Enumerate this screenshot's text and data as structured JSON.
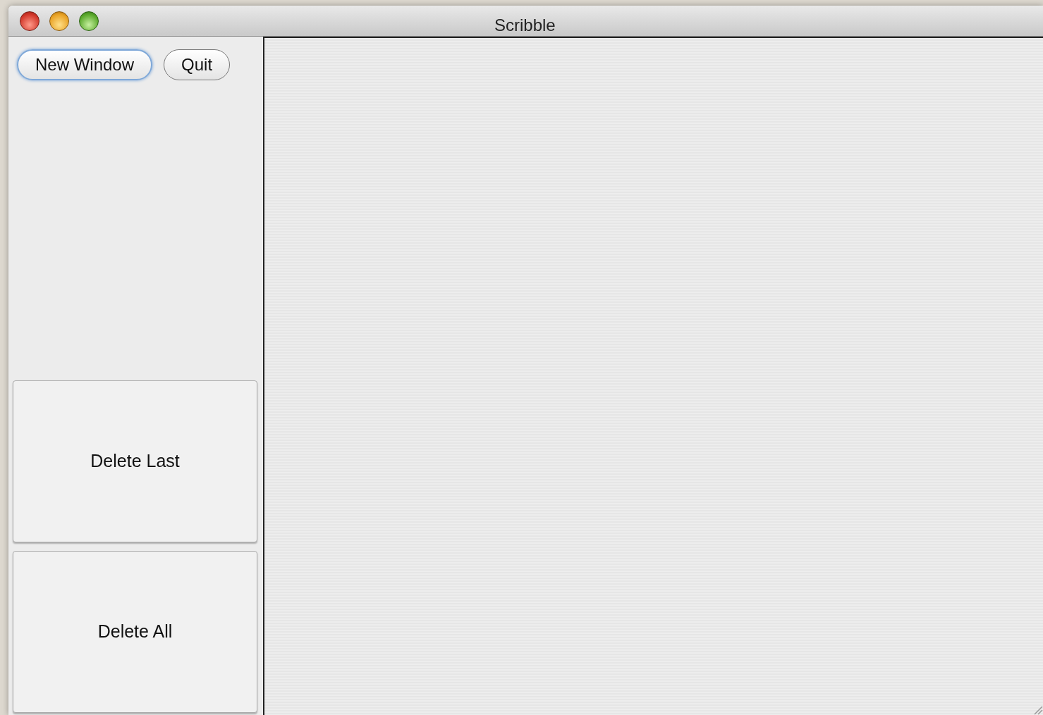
{
  "window": {
    "title": "Scribble"
  },
  "top_buttons": [
    {
      "label": "New Window",
      "default": true
    },
    {
      "label": "Quit",
      "default": false
    }
  ],
  "action_buttons": [
    {
      "label": "Delete Last"
    },
    {
      "label": "Delete All"
    }
  ]
}
